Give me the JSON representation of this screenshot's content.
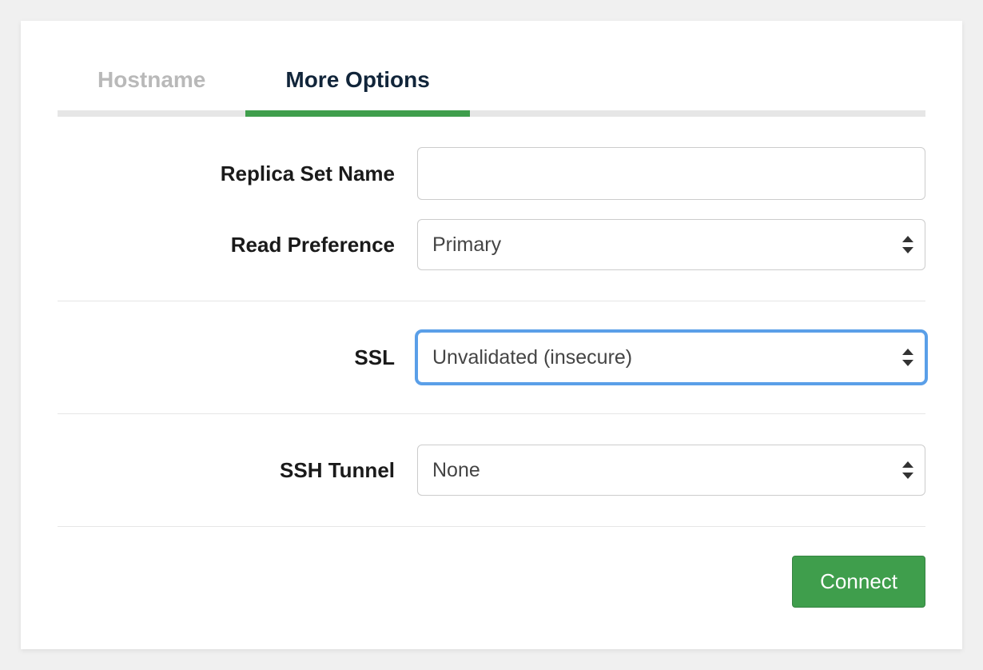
{
  "tabs": {
    "hostname": {
      "label": "Hostname",
      "active": false
    },
    "more_options": {
      "label": "More Options",
      "active": true
    }
  },
  "form": {
    "replica_set": {
      "label": "Replica Set Name",
      "value": ""
    },
    "read_preference": {
      "label": "Read Preference",
      "selected": "Primary"
    },
    "ssl": {
      "label": "SSL",
      "selected": "Unvalidated (insecure)",
      "focused": true
    },
    "ssh_tunnel": {
      "label": "SSH Tunnel",
      "selected": "None"
    }
  },
  "actions": {
    "connect_label": "Connect"
  },
  "colors": {
    "accent_green": "#3f9e4c",
    "focus_blue": "#5a9fe8",
    "border_gray": "#cccccc",
    "tab_inactive": "#b9b9b9",
    "tab_active": "#11253a"
  }
}
